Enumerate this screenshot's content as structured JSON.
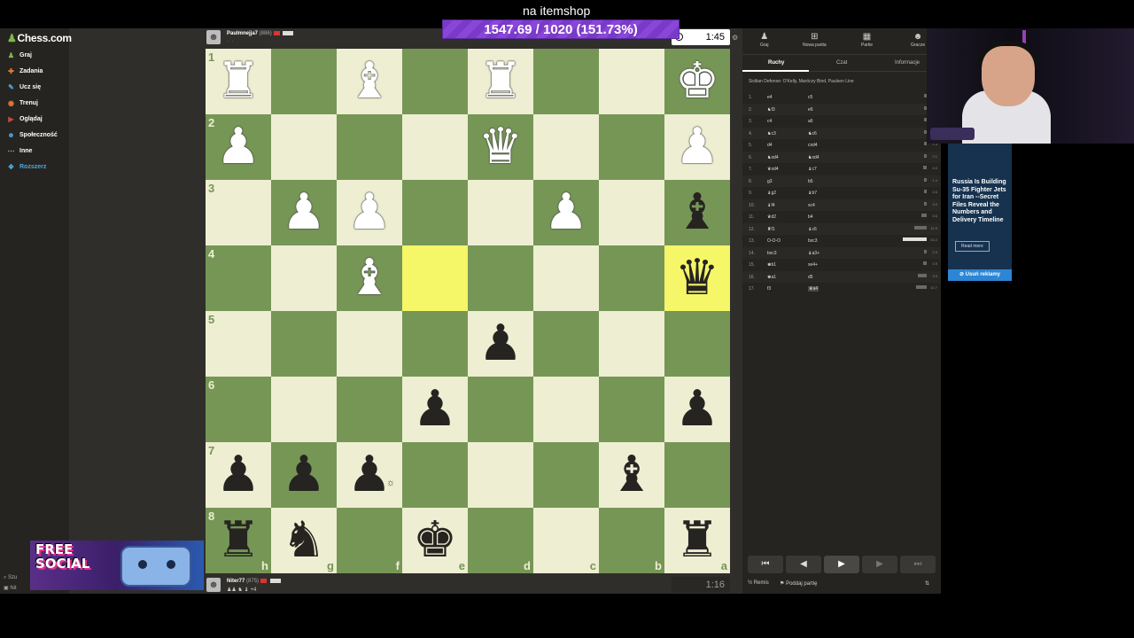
{
  "stream": {
    "goal_title": "na itemshop",
    "goal_progress": "1547.69 / 1020 (151.73%)",
    "goal_fraction": 1.5173
  },
  "site": {
    "logo": "Chess.com",
    "nav": [
      {
        "label": "Graj",
        "icon": "play-icon",
        "color": "#81b64c"
      },
      {
        "label": "Zadania",
        "icon": "puzzle-icon",
        "color": "#e8793a"
      },
      {
        "label": "Ucz się",
        "icon": "learn-icon",
        "color": "#4ea6df"
      },
      {
        "label": "Trenuj",
        "icon": "train-icon",
        "color": "#e8793a"
      },
      {
        "label": "Oglądaj",
        "icon": "watch-icon",
        "color": "#c9483e"
      },
      {
        "label": "Społeczność",
        "icon": "community-icon",
        "color": "#4ea6df"
      },
      {
        "label": "Inne",
        "icon": "more-icon",
        "color": "#bbbbbb"
      },
      {
        "label": "Rozszerz",
        "icon": "expand-icon",
        "color": "#4ea6df"
      }
    ],
    "search_label": "Szu",
    "bottom_label": "Nit"
  },
  "players": {
    "top": {
      "name": "Paulmnejja7",
      "rating": "(886)",
      "clock": "1:45"
    },
    "bottom": {
      "name": "Niter77",
      "rating": "(875)",
      "captured": "+4",
      "clock": "1:16"
    }
  },
  "board": {
    "ranks": [
      "1",
      "2",
      "3",
      "4",
      "5",
      "6",
      "7",
      "8"
    ],
    "files": [
      "h",
      "g",
      "f",
      "e",
      "d",
      "c",
      "b",
      "a"
    ],
    "rows": [
      [
        {
          "p": "♜",
          "c": "w"
        },
        null,
        {
          "p": "♝",
          "c": "w"
        },
        null,
        {
          "p": "♜",
          "c": "w"
        },
        null,
        null,
        {
          "p": "♚",
          "c": "w"
        }
      ],
      [
        {
          "p": "♟",
          "c": "w"
        },
        null,
        null,
        null,
        {
          "p": "♛",
          "c": "w"
        },
        null,
        null,
        {
          "p": "♟",
          "c": "w"
        }
      ],
      [
        null,
        {
          "p": "♟",
          "c": "w"
        },
        {
          "p": "♟",
          "c": "w"
        },
        null,
        null,
        {
          "p": "♟",
          "c": "w"
        },
        null,
        {
          "p": "♝",
          "c": "b"
        }
      ],
      [
        null,
        null,
        {
          "p": "♝",
          "c": "w"
        },
        {
          "hl": true
        },
        null,
        null,
        null,
        {
          "p": "♛",
          "c": "b",
          "hl": true
        }
      ],
      [
        null,
        null,
        null,
        null,
        {
          "p": "♟",
          "c": "b"
        },
        null,
        null,
        null
      ],
      [
        null,
        null,
        null,
        {
          "p": "♟",
          "c": "b"
        },
        null,
        null,
        null,
        {
          "p": "♟",
          "c": "b"
        }
      ],
      [
        {
          "p": "♟",
          "c": "b"
        },
        {
          "p": "♟",
          "c": "b"
        },
        {
          "p": "♟",
          "c": "b"
        },
        null,
        null,
        null,
        {
          "p": "♝",
          "c": "b"
        },
        null
      ],
      [
        {
          "p": "♜",
          "c": "b"
        },
        {
          "p": "♞",
          "c": "b"
        },
        null,
        {
          "p": "♚",
          "c": "b"
        },
        null,
        null,
        null,
        {
          "p": "♜",
          "c": "b"
        }
      ]
    ]
  },
  "panel": {
    "top_tabs": [
      {
        "label": "Graj",
        "icon": "play-icon"
      },
      {
        "label": "Nowa partia",
        "icon": "new-game-icon"
      },
      {
        "label": "Partie",
        "icon": "games-icon"
      },
      {
        "label": "Gracze",
        "icon": "players-icon"
      }
    ],
    "sub_tabs": [
      "Ruchy",
      "Czat",
      "Informacje"
    ],
    "opening": "Sicilian Defense: O'Kelly, Maróczy Bind, Paulsen Line",
    "moves": [
      {
        "n": "1.",
        "w": "e4",
        "b": "c5",
        "t": "0.2"
      },
      {
        "n": "2.",
        "w": "♞f3",
        "b": "e6",
        "t": "1.0"
      },
      {
        "n": "3.",
        "w": "c4",
        "b": "a6",
        "t": "1.0"
      },
      {
        "n": "4.",
        "w": "♞c3",
        "b": "♞c6",
        "t": "1.2"
      },
      {
        "n": "5.",
        "w": "d4",
        "b": "cxd4",
        "t": "1.3"
      },
      {
        "n": "6.",
        "w": "♞xd4",
        "b": "♞xd4",
        "t": "2.1"
      },
      {
        "n": "7.",
        "w": "♛xd4",
        "b": "♝c7",
        "t": "4.0"
      },
      {
        "n": "8.",
        "w": "g3",
        "b": "b5",
        "t": "1.4"
      },
      {
        "n": "9.",
        "w": "♝g2",
        "b": "♝b7",
        "t": "2.6"
      },
      {
        "n": "10.",
        "w": "♝f4",
        "b": "xc4",
        "t": "3.0"
      },
      {
        "n": "11.",
        "w": "♛d2",
        "b": "b4",
        "t": "5.6"
      },
      {
        "n": "12.",
        "w": "♜f1",
        "b": "♝c6",
        "t": "12.9"
      },
      {
        "n": "13.",
        "w": "O-O-O",
        "b": "bxc3",
        "t": "24.2"
      },
      {
        "n": "14.",
        "w": "bxc3",
        "b": "♝a3+",
        "t": "2.3"
      },
      {
        "n": "15.",
        "w": "♚b1",
        "b": "xe4+",
        "t": "3.9"
      },
      {
        "n": "16.",
        "w": "♚a1",
        "b": "d5",
        "t": "9.3"
      },
      {
        "n": "17.",
        "w": "f3",
        "b": "♛a4",
        "t": "10.7"
      }
    ],
    "footer_draw": "Remis",
    "footer_resign": "Poddaj partię"
  },
  "ad": {
    "text": "Russia Is Building Su-35 Fighter Jets for Iran --Secret Files Reveal the Numbers and Delivery Timeline",
    "read_more": "Read more",
    "remove": "Usuń reklamy"
  },
  "promo": {
    "line1": "FREE",
    "line2": "SOCIAL"
  },
  "colors": {
    "light_square": "#eeeed2",
    "dark_square": "#769656",
    "highlight": "#f6f669",
    "goal_bar": "#7a3ac8"
  }
}
